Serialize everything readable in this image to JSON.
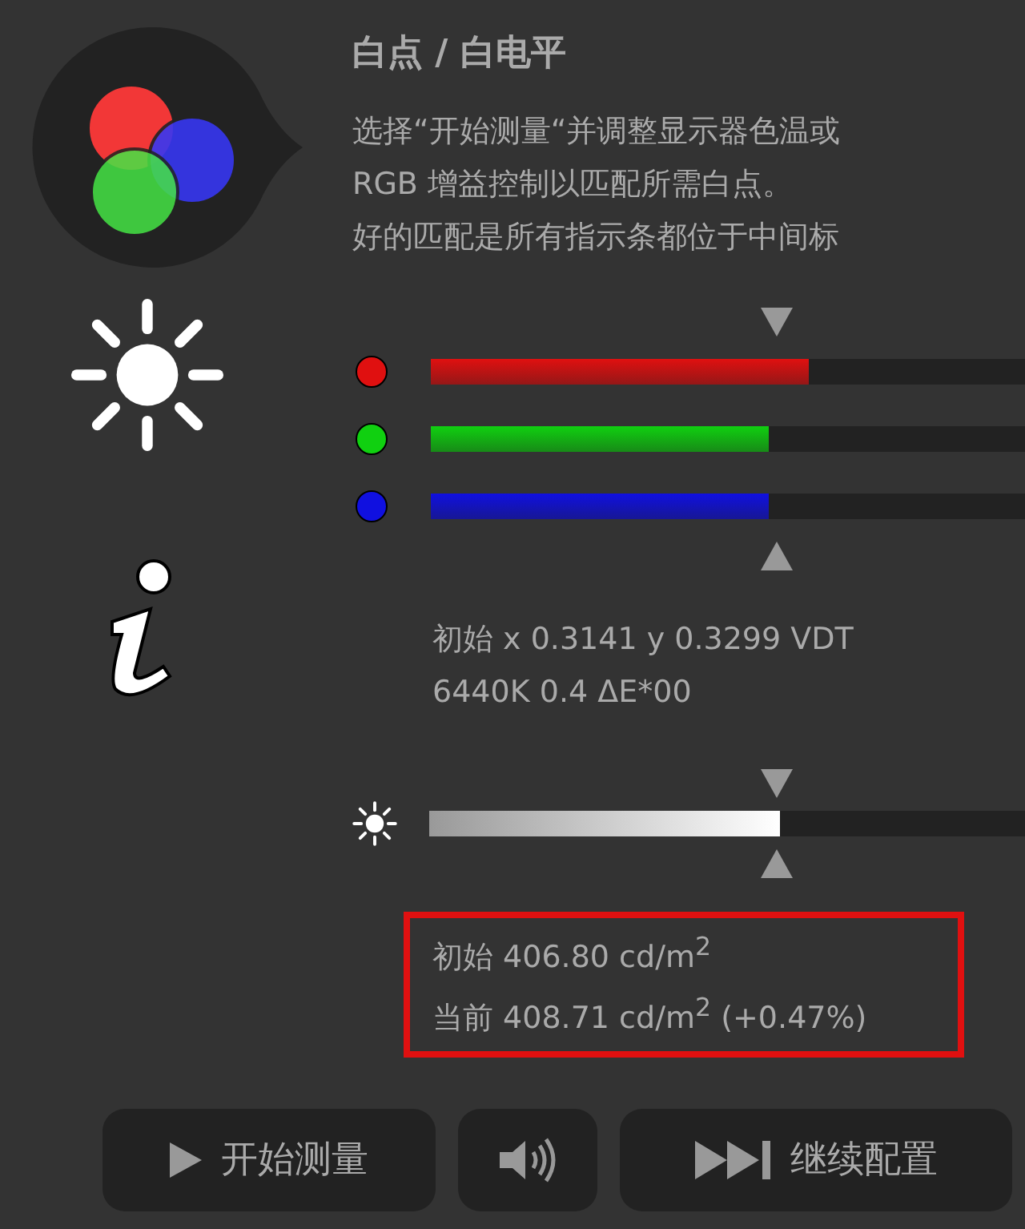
{
  "title": "白点 / 白电平",
  "description": [
    "选择“开始测量“并调整显示器色温或",
    "RGB 增益控制以匹配所需白点。",
    "好的匹配是所有指示条都位于中间标"
  ],
  "channels": [
    {
      "color": "#e01010",
      "level": 0.635
    },
    {
      "color": "#10d010",
      "level": 0.57
    },
    {
      "color": "#1010e0",
      "level": 0.57
    }
  ],
  "readings": [
    "初始 x 0.3141 y 0.3299 VDT",
    "6440K 0.4 ΔE*00"
  ],
  "luminance": {
    "level": 0.59
  },
  "luminance_readings": [
    "初始 406.80 cd/m$^{2}$",
    "当前 408.71 cd/m$^{2}$ (+0.47%)"
  ],
  "buttons": [
    {
      "kind": "play",
      "label": "开始测量"
    },
    {
      "kind": "sound"
    },
    {
      "kind": "skip",
      "label": "继续配置"
    }
  ]
}
